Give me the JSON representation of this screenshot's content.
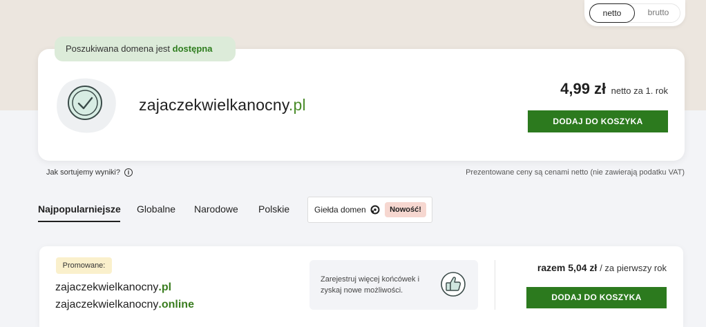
{
  "price_toggle": {
    "options": [
      "netto",
      "brutto"
    ],
    "selected": "netto"
  },
  "availability": {
    "prefix": "Poszukiwana domena jest",
    "status": "dostępna"
  },
  "result": {
    "domain_base": "zajaczekwielkanocny",
    "domain_tld": ".pl",
    "price": "4,99 zł",
    "price_note": "netto za 1. rok",
    "add_to_cart_label": "DODAJ DO KOSZYKA"
  },
  "info_row": {
    "sort_question": "Jak sortujemy wyniki?",
    "info_icon": "info-icon",
    "vat_note": "Prezentowane ceny są cenami netto (nie zawierają podatku VAT)"
  },
  "tabs": [
    {
      "label": "Najpopularniejsze",
      "active": true
    },
    {
      "label": "Globalne",
      "active": false
    },
    {
      "label": "Narodowe",
      "active": false
    },
    {
      "label": "Polskie",
      "active": false
    }
  ],
  "exchange_tab": {
    "label": "Giełda domen",
    "icon": "exchange-icon",
    "badge": "Nowość!"
  },
  "promo": {
    "badge": "Promowane:",
    "domains": [
      {
        "base": "zajaczekwielkanocny",
        "tld": ".pl"
      },
      {
        "base": "zajaczekwielkanocny",
        "tld": ".online"
      }
    ],
    "info_text": "Zarejestruj więcej końcówek i zyskaj nowe możliwości.",
    "info_icon": "thumbs-up-icon",
    "total_label": "razem 5,04 zł",
    "total_note": "/ za pierwszy rok",
    "add_to_cart_label": "DODAJ DO KOSZYKA"
  },
  "colors": {
    "accent_green": "#2c7a1e",
    "tld_green": "#4a8c2a",
    "badge_green_bg": "#dcebd9",
    "promo_badge_bg": "#faf0cc",
    "new_badge_bg": "#f6d7d0",
    "top_band": "#ece6df"
  }
}
